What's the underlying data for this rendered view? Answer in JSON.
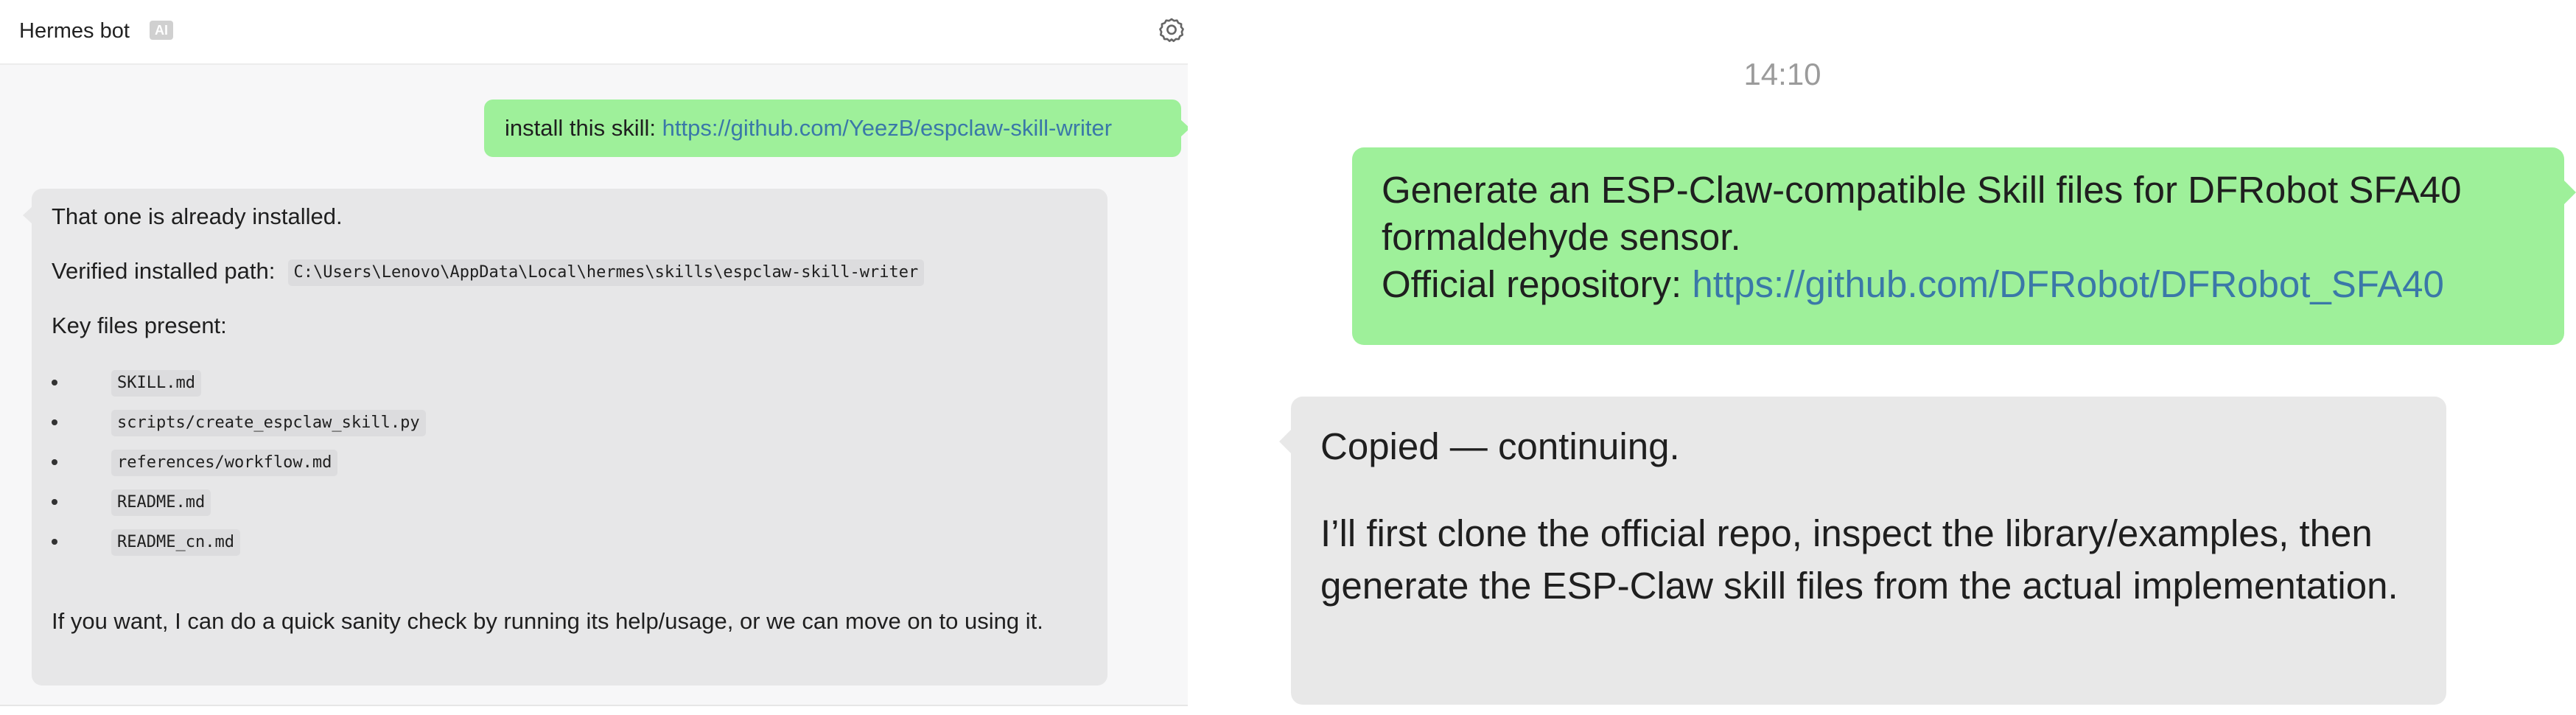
{
  "left": {
    "header": {
      "title": "Hermes bot",
      "badge": "AI",
      "settings_icon": "gear-icon"
    },
    "user_message": {
      "prefix": "install this skill: ",
      "link": "https://github.com/YeezB/espclaw-skill-writer"
    },
    "bot_message": {
      "line1": "That one is already installed.",
      "path_label": "Verified installed path:",
      "path_value": "C:\\Users\\Lenovo\\AppData\\Local\\hermes\\skills\\espclaw-skill-writer",
      "key_files_label": "Key files present:",
      "files": [
        "SKILL.md",
        "scripts/create_espclaw_skill.py",
        "references/workflow.md",
        "README.md",
        "README_cn.md"
      ],
      "closing": "If you want, I can do a quick sanity check by running its help/usage, or we can move on to using it."
    }
  },
  "right": {
    "timestamp": "14:10",
    "user_message": {
      "line1": "Generate an ESP-Claw-compatible Skill files for DFRobot SFA40",
      "line2": "formaldehyde sensor.",
      "line3_prefix": "Official repository: ",
      "line3_link": "https://github.com/DFRobot/DFRobot_SFA40"
    },
    "bot_message": {
      "line1": "Copied — continuing.",
      "paragraph": "I’ll first clone the official repo, inspect the library/examples, then generate the ESP-Claw skill files from the actual implementation."
    }
  },
  "colors": {
    "user_bubble": "#9ef09a",
    "bot_bubble": "#e7e7e8",
    "link": "#3a78a8",
    "timestamp": "#9b9b9b"
  }
}
